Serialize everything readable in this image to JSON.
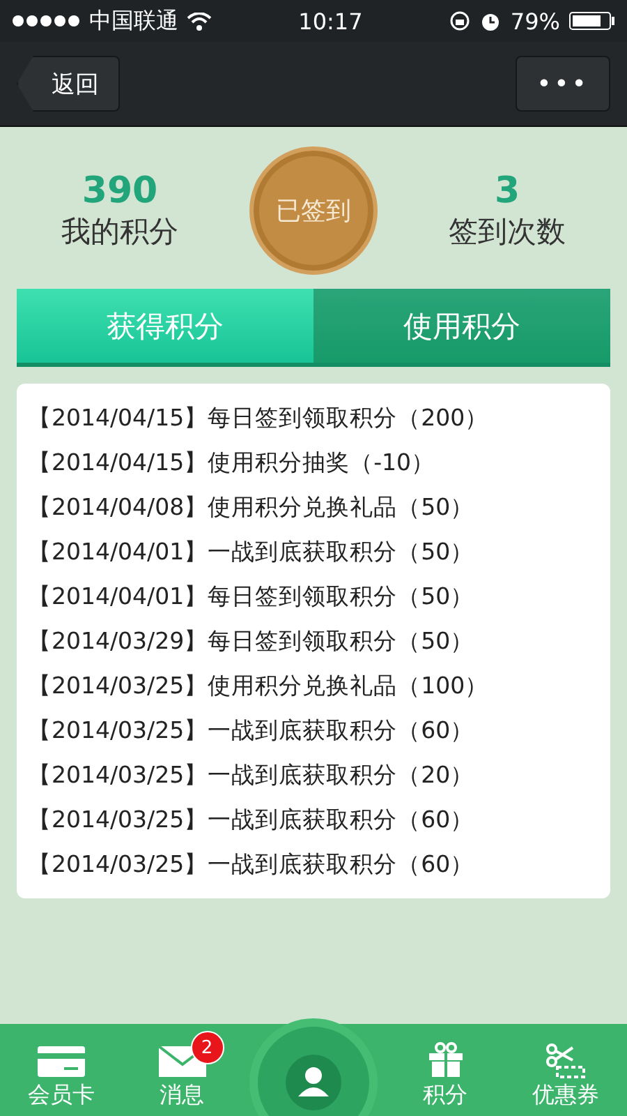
{
  "status_bar": {
    "carrier": "中国联通",
    "time": "10:17",
    "battery": "79%"
  },
  "nav": {
    "back": "返回",
    "more": "•••"
  },
  "summary": {
    "points": "390",
    "points_label": "我的积分",
    "checkin": "已签到",
    "count": "3",
    "count_label": "签到次数"
  },
  "tabs": [
    {
      "label": "获得积分",
      "selected": true
    },
    {
      "label": "使用积分",
      "selected": false
    }
  ],
  "records": [
    "【2014/04/15】每日签到领取积分（200）",
    "【2014/04/15】使用积分抽奖（-10）",
    "【2014/04/08】使用积分兑换礼品（50）",
    "【2014/04/01】一战到底获取积分（50）",
    "【2014/04/01】每日签到领取积分（50）",
    "【2014/03/29】每日签到领取积分（50）",
    "【2014/03/25】使用积分兑换礼品（100）",
    "【2014/03/25】一战到底获取积分（60）",
    "【2014/03/25】一战到底获取积分（20）",
    "【2014/03/25】一战到底获取积分（60）",
    "【2014/03/25】一战到底获取积分（60）"
  ],
  "bottom_bar": [
    {
      "kind": "card",
      "label": "会员卡"
    },
    {
      "kind": "mail",
      "label": "消息",
      "badge": "2"
    },
    {
      "kind": "center"
    },
    {
      "kind": "gift",
      "label": "积分"
    },
    {
      "kind": "coupon",
      "label": "优惠券"
    }
  ]
}
